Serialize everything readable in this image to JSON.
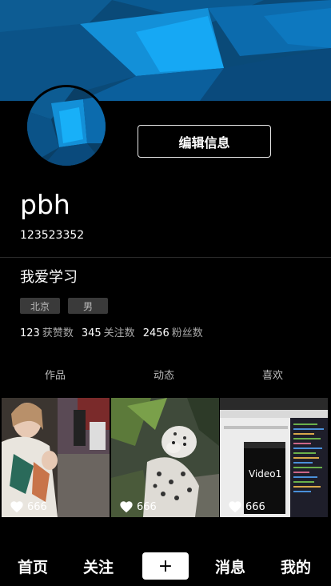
{
  "profile": {
    "username": "pbh",
    "user_id": "123523352",
    "bio": "我爱学习",
    "tags": {
      "city": "北京",
      "gender": "男"
    }
  },
  "edit_button": {
    "label": "编辑信息"
  },
  "stats": [
    {
      "value": "123",
      "label": "获赞数"
    },
    {
      "value": "345",
      "label": "关注数"
    },
    {
      "value": "2456",
      "label": "粉丝数"
    }
  ],
  "tabs": [
    {
      "label": "作品"
    },
    {
      "label": "动态"
    },
    {
      "label": "喜欢"
    }
  ],
  "videos": [
    {
      "likes": "666",
      "icon": "heart-icon"
    },
    {
      "likes": "666",
      "icon": "heart-icon"
    },
    {
      "likes": "666",
      "icon": "heart-icon",
      "overlay_text": "Video1"
    }
  ],
  "bottom_nav": {
    "home": "首页",
    "follow": "关注",
    "plus": "+",
    "messages": "消息",
    "me": "我的"
  },
  "colors": {
    "background": "#000000",
    "cover_blue": "#0b4d7c",
    "accent_blue": "#12a4f5"
  }
}
